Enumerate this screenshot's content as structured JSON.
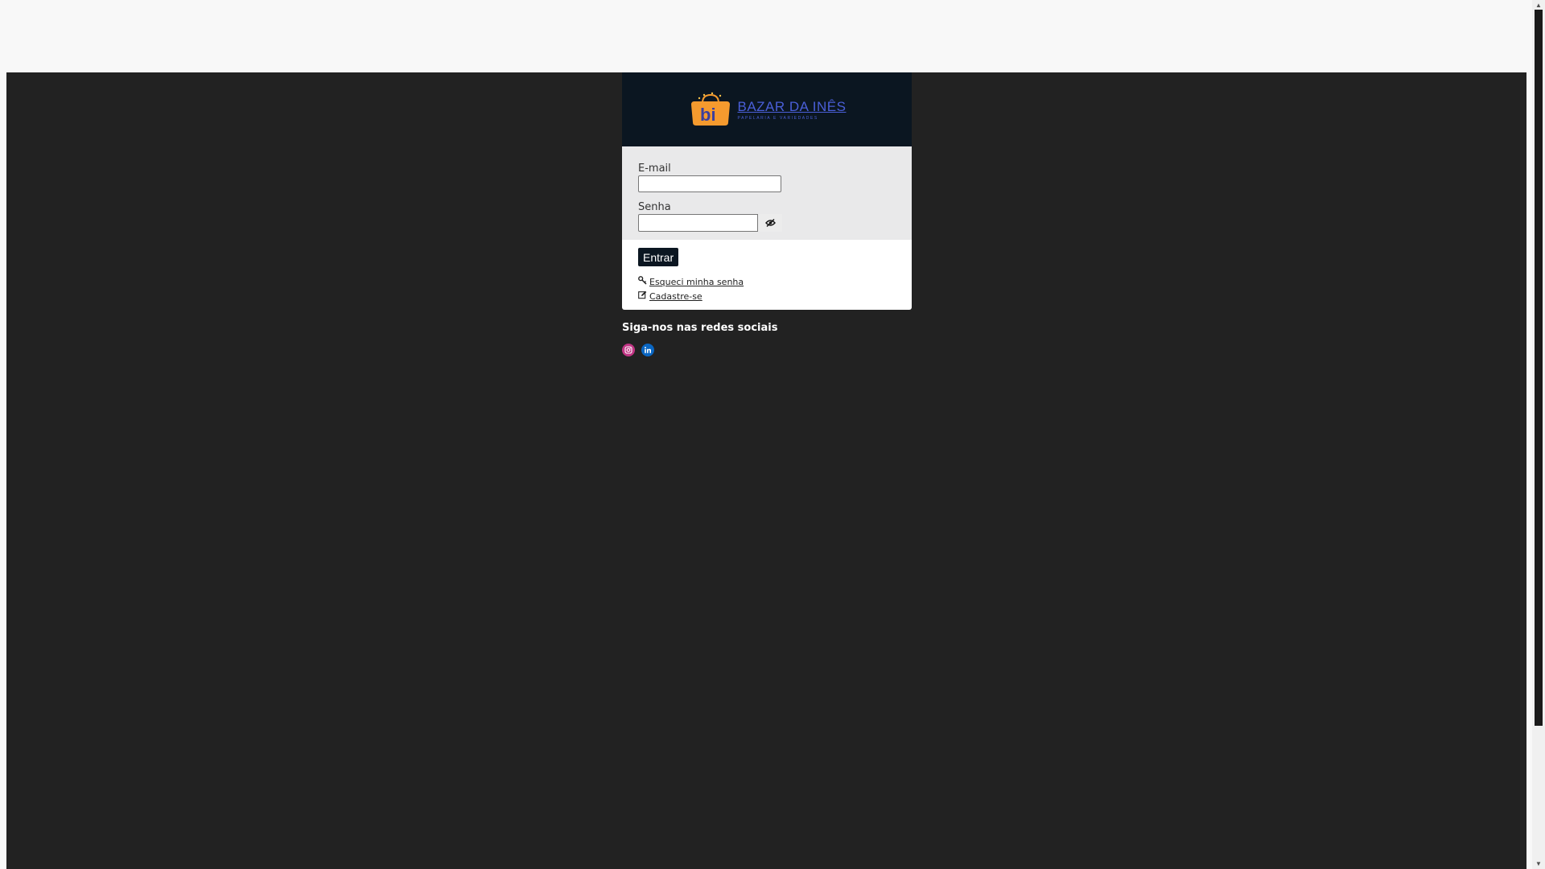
{
  "brand": {
    "logo_mark": "bi",
    "name": "BAZAR DA INÊS",
    "tagline": "PAPELARIA E VARIEDADES"
  },
  "login": {
    "email_label": "E-mail",
    "email_value": "",
    "password_label": "Senha",
    "password_value": "",
    "submit_label": "Entrar",
    "forgot_label": " Esqueci minha senha",
    "signup_label": " Cadastre-se"
  },
  "social": {
    "title": "Siga-nos nas redes sociais",
    "icons": [
      "instagram-icon",
      "linkedin-icon"
    ]
  },
  "colors": {
    "header_bg": "#0b1621",
    "page_bg": "#222222",
    "logo_accent": "#f59a2e",
    "logo_text": "#4a5fd8"
  }
}
